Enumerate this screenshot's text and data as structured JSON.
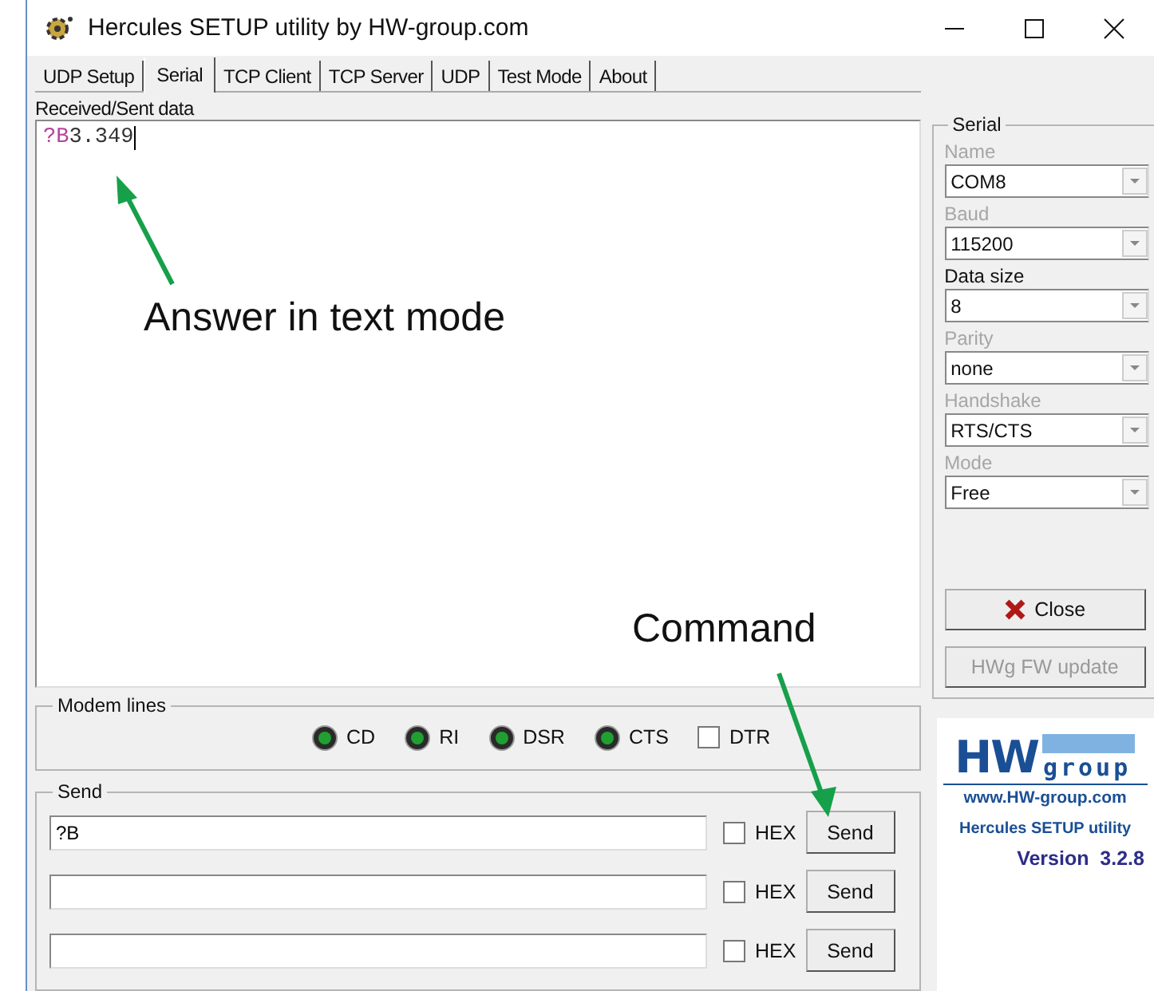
{
  "window": {
    "title": "Hercules SETUP utility by HW-group.com"
  },
  "tabs": [
    {
      "label": "UDP Setup",
      "selected": false
    },
    {
      "label": "Serial",
      "selected": true
    },
    {
      "label": "TCP Client",
      "selected": false
    },
    {
      "label": "TCP Server",
      "selected": false
    },
    {
      "label": "UDP",
      "selected": false
    },
    {
      "label": "Test Mode",
      "selected": false
    },
    {
      "label": "About",
      "selected": false
    }
  ],
  "received": {
    "label": "Received/Sent data",
    "segments": [
      {
        "text": "?B",
        "color": "#b4449c"
      },
      {
        "text": "3.349",
        "color": "#333333"
      }
    ]
  },
  "modem_lines": {
    "title": "Modem lines",
    "leds": [
      {
        "label": "CD",
        "on": true
      },
      {
        "label": "RI",
        "on": true
      },
      {
        "label": "DSR",
        "on": true
      },
      {
        "label": "CTS",
        "on": true
      }
    ],
    "dtr": {
      "label": "DTR",
      "checked": false
    }
  },
  "send": {
    "title": "Send",
    "rows": [
      {
        "value": "?B",
        "hex_label": "HEX",
        "hex_checked": false,
        "button": "Send"
      },
      {
        "value": "",
        "hex_label": "HEX",
        "hex_checked": false,
        "button": "Send"
      },
      {
        "value": "",
        "hex_label": "HEX",
        "hex_checked": false,
        "button": "Send"
      }
    ]
  },
  "serial": {
    "title": "Serial",
    "fields": [
      {
        "label": "Name",
        "value": "COM8",
        "disabled": true
      },
      {
        "label": "Baud",
        "value": "115200",
        "disabled": true
      },
      {
        "label": "Data size",
        "value": "8",
        "disabled": false
      },
      {
        "label": "Parity",
        "value": "none",
        "disabled": true
      },
      {
        "label": "Handshake",
        "value": "RTS/CTS",
        "disabled": true
      },
      {
        "label": "Mode",
        "value": "Free",
        "disabled": true
      }
    ]
  },
  "buttons": [
    {
      "label": "Close",
      "kind": "close",
      "disabled": false
    },
    {
      "label": "HWg FW update",
      "kind": "plain",
      "disabled": true
    }
  ],
  "logo": {
    "mark": "HW",
    "wordmark": "group",
    "url": "www.HW-group.com",
    "product": "Hercules SETUP utility",
    "version": "Version  3.2.8"
  },
  "annotations": [
    {
      "text": "Answer in text mode"
    },
    {
      "text": "Command"
    }
  ]
}
